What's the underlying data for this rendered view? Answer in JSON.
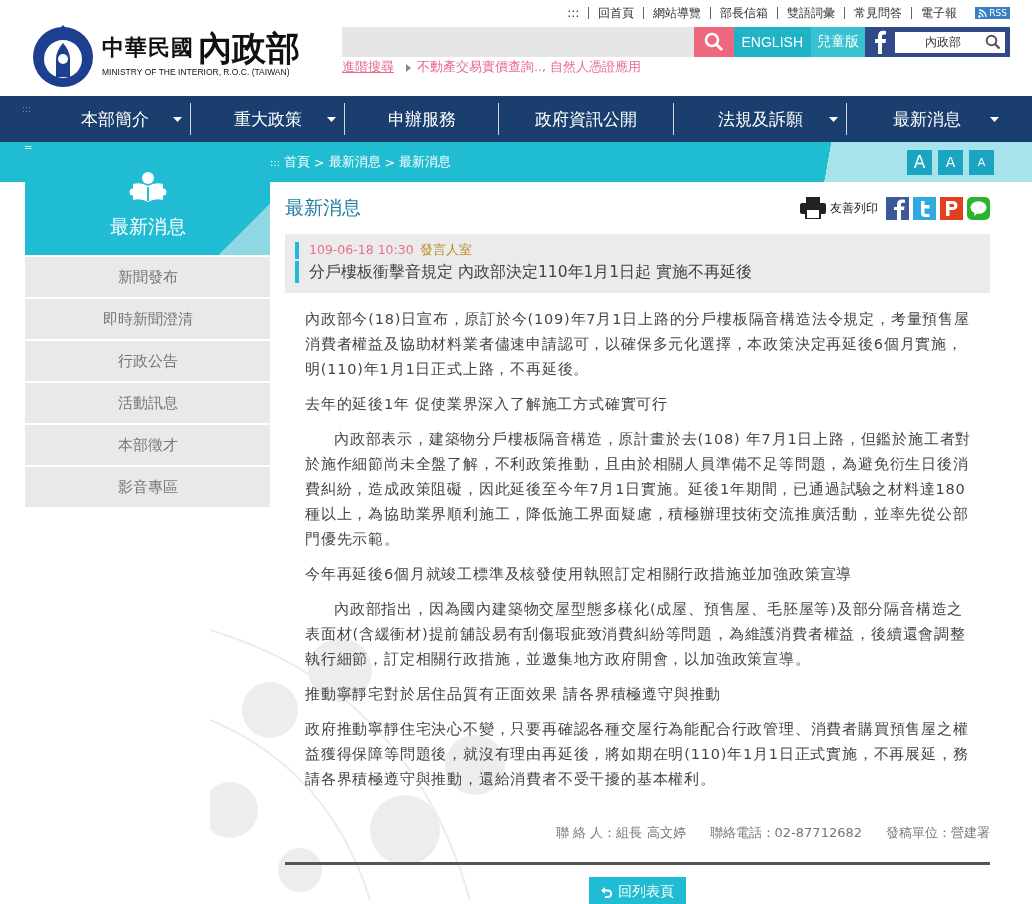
{
  "header": {
    "logo": {
      "title_small": "中華民國",
      "title_big": "內政部",
      "subtitle": "MINISTRY OF THE INTERIOR, R.O.C. (TAIWAN)"
    },
    "top_links": [
      ":::",
      "回首頁",
      "網站導覽",
      "部長信箱",
      "雙語詞彙",
      "常見問答",
      "電子報"
    ],
    "rss": "RSS",
    "english": "ENGLISH",
    "kids": "兒童版",
    "site_search": {
      "value": "內政部"
    },
    "advanced_search": "進階搜尋",
    "hot_keywords": "不動產交易實價查詢.., 自然人憑證應用"
  },
  "nav": {
    "marker": ":::",
    "items": [
      {
        "label": "本部簡介",
        "dropdown": true
      },
      {
        "label": "重大政策",
        "dropdown": true
      },
      {
        "label": "申辦服務",
        "dropdown": false
      },
      {
        "label": "政府資訊公開",
        "dropdown": false
      },
      {
        "label": "法規及訴願",
        "dropdown": true
      },
      {
        "label": "最新消息",
        "dropdown": true
      }
    ]
  },
  "breadcrumb": {
    "marker": ":::",
    "items": [
      "首頁",
      "最新消息",
      "最新消息"
    ],
    "separator": ">"
  },
  "font_sizes": [
    {
      "label": "A",
      "kind": "large"
    },
    {
      "label": "A",
      "kind": "medium"
    },
    {
      "label": "A",
      "kind": "small"
    }
  ],
  "sidebar": {
    "marker": "=",
    "title": "最新消息",
    "items": [
      {
        "label": "新聞發布",
        "selected": false
      },
      {
        "label": "即時新聞澄清",
        "selected": false
      },
      {
        "label": "行政公告",
        "selected": false
      },
      {
        "label": "活動訊息",
        "selected": false
      },
      {
        "label": "本部徵才",
        "selected": false
      },
      {
        "label": "影音專區",
        "selected": false
      }
    ]
  },
  "article": {
    "page_title": "最新消息",
    "print": "友善列印",
    "date": "109-06-18 10:30",
    "unit": "發言人室",
    "title": "分戶樓板衝擊音規定 內政部決定110年1月1日起 實施不再延後",
    "blocks": [
      {
        "kind": "lead",
        "text": "內政部今(18)日宣布，原訂於今(109)年7月1日上路的分戶樓板隔音構造法令規定，考量預售屋消費者權益及協助材料業者儘速申請認可，以確保多元化選擇，本政策決定再延後6個月實施，明(110)年1月1日正式上路，不再延後。"
      },
      {
        "kind": "subheading",
        "text": "去年的延後1年 促使業界深入了解施工方式確實可行"
      },
      {
        "kind": "body",
        "text": "內政部表示，建築物分戶樓板隔音構造，原計畫於去(108) 年7月1日上路，但鑑於施工者對於施作細節尚未全盤了解，不利政策推動，且由於相關人員準備不足等問題，為避免衍生日後消費糾紛，造成政策阻礙，因此延後至今年7月1日實施。延後1年期間，已通過試驗之材料達180種以上，為協助業界順利施工，降低施工界面疑慮，積極辦理技術交流推廣活動，並率先從公部門優先示範。"
      },
      {
        "kind": "subheading",
        "text": "今年再延後6個月就竣工標準及核發使用執照訂定相關行政措施並加強政策宣導"
      },
      {
        "kind": "body",
        "text": "內政部指出，因為國內建築物交屋型態多樣化(成屋、預售屋、毛胚屋等)及部分隔音構造之表面材(含緩衝材)提前舖設易有刮傷瑕疵致消費糾紛等問題，為維護消費者權益，後續還會調整執行細節，訂定相關行政措施，並邀集地方政府開會，以加強政策宣導。"
      },
      {
        "kind": "subheading",
        "text": "推動寧靜宅對於居住品質有正面效果 請各界積極遵守與推動"
      },
      {
        "kind": "lead",
        "text": "政府推動寧靜住宅決心不變，只要再確認各種交屋行為能配合行政管理、消費者購買預售屋之權益獲得保障等問題後，就沒有理由再延後，將如期在明(110)年1月1日正式實施，不再展延，務請各界積極遵守與推動，還給消費者不受干擾的基本權利。"
      }
    ],
    "contacts": [
      "聯 絡 人：組長 高文婷",
      "聯絡電話：02-87712682",
      "發稿單位：營建署"
    ],
    "back": "回列表頁"
  }
}
